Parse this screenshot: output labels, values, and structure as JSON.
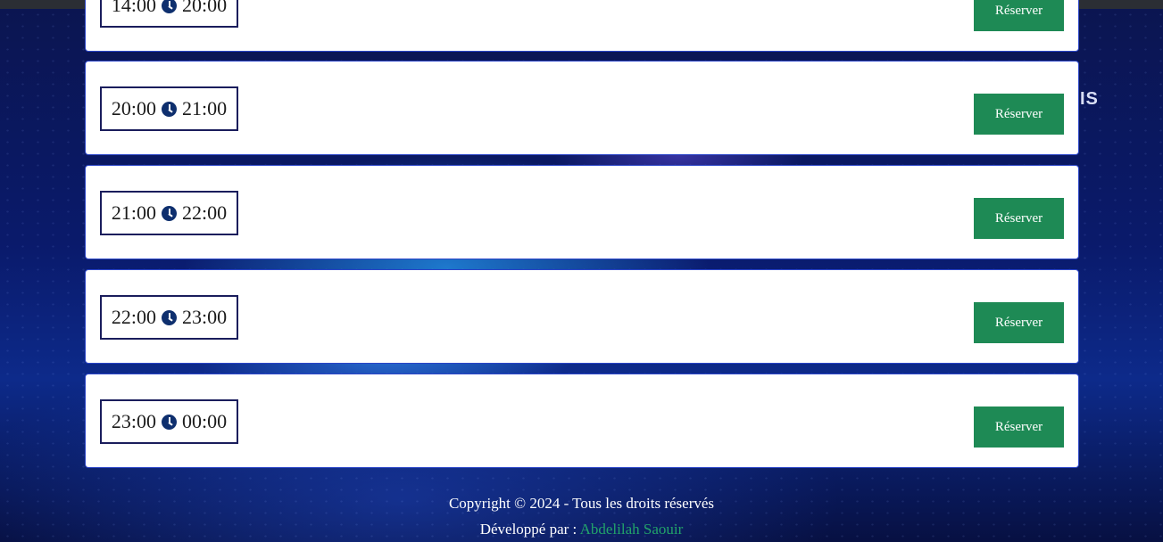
{
  "slots": [
    {
      "start": "14:00",
      "end": "20:00",
      "button": "Réserver"
    },
    {
      "start": "20:00",
      "end": "21:00",
      "button": "Réserver"
    },
    {
      "start": "21:00",
      "end": "22:00",
      "button": "Réserver"
    },
    {
      "start": "22:00",
      "end": "23:00",
      "button": "Réserver"
    },
    {
      "start": "23:00",
      "end": "00:00",
      "button": "Réserver"
    }
  ],
  "side_mark": "IS",
  "footer": {
    "copyright": "Copyright © 2024 - Tous les droits réservés",
    "developed_by": "Développé par :",
    "developer_name": "Abdelilah Saouir"
  },
  "colors": {
    "button": "#1e8a55",
    "developer_name": "#22a36a",
    "time_border": "#1a1d5c",
    "clock_icon": "#0e2f6e"
  },
  "icons": {
    "time_separator": "clock-icon"
  }
}
